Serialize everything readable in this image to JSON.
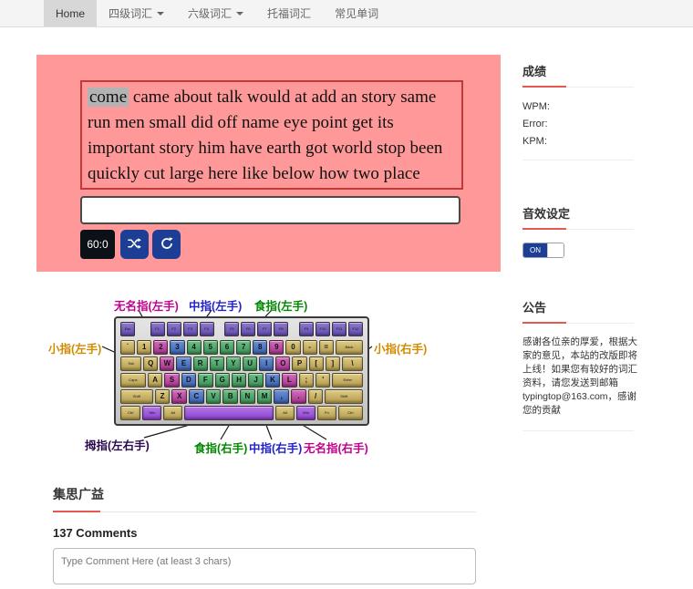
{
  "nav": {
    "items": [
      {
        "label": "Home"
      },
      {
        "label": "四级词汇"
      },
      {
        "label": "六级词汇"
      },
      {
        "label": "托福词汇"
      },
      {
        "label": "常见单词"
      }
    ]
  },
  "practice": {
    "current_word": "come",
    "remaining_words": " came about talk would at add an story same run men small did off name eye point get its important story him have earth got world stop been quickly cut large here like below how two place",
    "input_value": "",
    "timer_button": "60:0",
    "shuffle_icon": "shuffle-icon",
    "refresh_icon": "refresh-icon",
    "panel_color": "#ff9999",
    "word_box_border": "#c03a3a",
    "button_blue": "#1c3e94"
  },
  "keyboard": {
    "legend": {
      "ring_left": "无名指(左手)",
      "middle_left": "中指(左手)",
      "index_left": "食指(左手)",
      "pinky_left": "小指(左手)",
      "pinky_right": "小指(右手)",
      "thumb": "拇指(左右手)",
      "index_right": "食指(右手)",
      "middle_right": "中指(右手)",
      "ring_right": "无名指(右手)"
    },
    "legend_colors": {
      "pinky": "#d18b00",
      "ring": "#c0008c",
      "middle": "#2222cc",
      "index": "#008800",
      "thumb": "#2a0a4a"
    },
    "rows": [
      [
        [
          "Esc",
          "fn",
          1
        ],
        [
          "",
          "gap",
          0.9
        ],
        [
          "F1",
          "fn",
          1
        ],
        [
          "F2",
          "fn",
          1
        ],
        [
          "F3",
          "fn",
          1
        ],
        [
          "F4",
          "fn",
          1
        ],
        [
          "",
          "gap",
          0.55
        ],
        [
          "F5",
          "fn",
          1
        ],
        [
          "F6",
          "fn",
          1
        ],
        [
          "F7",
          "fn",
          1
        ],
        [
          "F8",
          "fn",
          1
        ],
        [
          "",
          "gap",
          0.55
        ],
        [
          "F9",
          "fn",
          1
        ],
        [
          "F10",
          "fn",
          1
        ],
        [
          "F11",
          "fn",
          1
        ],
        [
          "F12",
          "fn",
          1
        ]
      ],
      [
        [
          "`",
          "p",
          1
        ],
        [
          "1",
          "p",
          1
        ],
        [
          "2",
          "r",
          1
        ],
        [
          "3",
          "m",
          1
        ],
        [
          "4",
          "i",
          1
        ],
        [
          "5",
          "i",
          1
        ],
        [
          "6",
          "i",
          1
        ],
        [
          "7",
          "i",
          1
        ],
        [
          "8",
          "m",
          1
        ],
        [
          "9",
          "r",
          1
        ],
        [
          "0",
          "p",
          1
        ],
        [
          "-",
          "p",
          1
        ],
        [
          "=",
          "p",
          1
        ],
        [
          "Back",
          "p",
          2
        ]
      ],
      [
        [
          "Tab",
          "p",
          1.5
        ],
        [
          "Q",
          "p",
          1
        ],
        [
          "W",
          "r",
          1
        ],
        [
          "E",
          "m",
          1
        ],
        [
          "R",
          "i",
          1
        ],
        [
          "T",
          "i",
          1
        ],
        [
          "Y",
          "i",
          1
        ],
        [
          "U",
          "i",
          1
        ],
        [
          "I",
          "m",
          1
        ],
        [
          "O",
          "r",
          1
        ],
        [
          "P",
          "p",
          1
        ],
        [
          "[",
          "p",
          1
        ],
        [
          "]",
          "p",
          1
        ],
        [
          "\\",
          "p",
          1.5
        ]
      ],
      [
        [
          "Caps",
          "p",
          1.8
        ],
        [
          "A",
          "p",
          1
        ],
        [
          "S",
          "r",
          1
        ],
        [
          "D",
          "m",
          1
        ],
        [
          "F",
          "i",
          1
        ],
        [
          "G",
          "i",
          1
        ],
        [
          "H",
          "i",
          1
        ],
        [
          "J",
          "i",
          1
        ],
        [
          "K",
          "m",
          1
        ],
        [
          "L",
          "r",
          1
        ],
        [
          ";",
          "p",
          1
        ],
        [
          "'",
          "p",
          1
        ],
        [
          "Enter",
          "p",
          2.2
        ]
      ],
      [
        [
          "Shift",
          "p",
          2.3
        ],
        [
          "Z",
          "p",
          1
        ],
        [
          "X",
          "r",
          1
        ],
        [
          "C",
          "m",
          1
        ],
        [
          "V",
          "i",
          1
        ],
        [
          "B",
          "i",
          1
        ],
        [
          "N",
          "i",
          1
        ],
        [
          "M",
          "i",
          1
        ],
        [
          ",",
          "m",
          1
        ],
        [
          ".",
          "r",
          1
        ],
        [
          "/",
          "p",
          1
        ],
        [
          "Shift",
          "p",
          2.7
        ]
      ],
      [
        [
          "Ctrl",
          "p",
          1.3
        ],
        [
          "Win",
          "t",
          1.2
        ],
        [
          "Alt",
          "p",
          1.2
        ],
        [
          "",
          "t",
          6.1
        ],
        [
          "Alt",
          "p",
          1.2
        ],
        [
          "Win",
          "t",
          1.2
        ],
        [
          "Fn",
          "p",
          1.2
        ],
        [
          "Ctrl",
          "p",
          1.6
        ]
      ]
    ]
  },
  "sidebar": {
    "score": {
      "title": "成绩",
      "items": [
        "WPM:",
        "Error:",
        "KPM:"
      ]
    },
    "sound": {
      "title": "音效设定",
      "on_label": "ON"
    },
    "notice": {
      "title": "公告",
      "text": "感谢各位亲的厚爱，根据大家的意见，本站的改版即将上线！如果您有较好的词汇资料，请您发送到邮箱typingtop@163.com，感谢您的贡献"
    }
  },
  "comments": {
    "title": "集思广益",
    "count_label": "137 Comments",
    "placeholder": "Type Comment Here (at least 3 chars)"
  }
}
